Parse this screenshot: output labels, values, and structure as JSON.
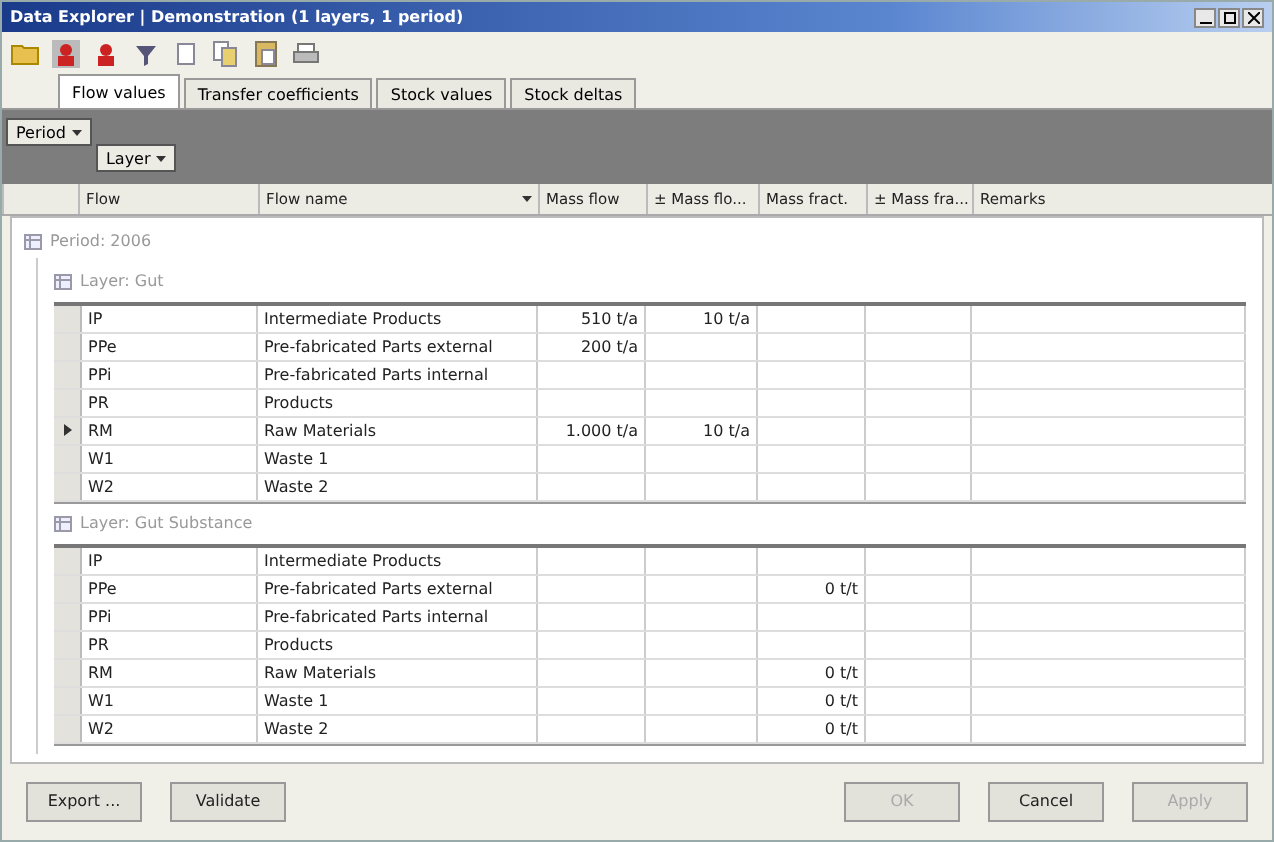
{
  "window": {
    "title": "Data Explorer | Demonstration (1 layers, 1 period)"
  },
  "tabs": [
    {
      "label": "Flow values",
      "selected": true
    },
    {
      "label": "Transfer coefficients",
      "selected": false
    },
    {
      "label": "Stock values",
      "selected": false
    },
    {
      "label": "Stock deltas",
      "selected": false
    }
  ],
  "grouping": [
    {
      "label": "Period"
    },
    {
      "label": "Layer"
    }
  ],
  "table": {
    "columns": [
      "Flow",
      "Flow name",
      "Mass flow",
      "± Mass flo...",
      "Mass fract.",
      "± Mass fra...",
      "Remarks"
    ],
    "period": "Period: 2006",
    "layers": [
      {
        "title": "Layer: Gut",
        "rows": [
          {
            "flow": "IP",
            "name": "Intermediate Products",
            "mass_flow": "510 t/a",
            "mass_flow_err": "10 t/a",
            "current": false
          },
          {
            "flow": "PPe",
            "name": "Pre-fabricated Parts external",
            "mass_flow": "200 t/a",
            "current": false
          },
          {
            "flow": "PPi",
            "name": "Pre-fabricated Parts internal",
            "current": false
          },
          {
            "flow": "PR",
            "name": "Products",
            "current": false
          },
          {
            "flow": "RM",
            "name": "Raw Materials",
            "mass_flow": "1.000 t/a",
            "mass_flow_err": "10 t/a",
            "current": true
          },
          {
            "flow": "W1",
            "name": "Waste 1",
            "current": false
          },
          {
            "flow": "W2",
            "name": "Waste 2",
            "current": false
          }
        ]
      },
      {
        "title": "Layer: Gut Substance",
        "rows": [
          {
            "flow": "IP",
            "name": "Intermediate Products",
            "current": false
          },
          {
            "flow": "PPe",
            "name": "Pre-fabricated Parts external",
            "mass_fraction": "0 t/t",
            "current": false
          },
          {
            "flow": "PPi",
            "name": "Pre-fabricated Parts internal",
            "current": false
          },
          {
            "flow": "PR",
            "name": "Products",
            "current": false
          },
          {
            "flow": "RM",
            "name": "Raw Materials",
            "mass_fraction": "0 t/t",
            "current": false
          },
          {
            "flow": "W1",
            "name": "Waste 1",
            "mass_fraction": "0 t/t",
            "current": false
          },
          {
            "flow": "W2",
            "name": "Waste 2",
            "mass_fraction": "0 t/t",
            "current": false
          }
        ]
      }
    ]
  },
  "buttons_left": [
    {
      "label": "Export ...",
      "disabled": false
    },
    {
      "label": "Validate",
      "disabled": false
    }
  ],
  "buttons_right": [
    {
      "label": "OK",
      "disabled": true
    },
    {
      "label": "Cancel",
      "disabled": false
    },
    {
      "label": "Apply",
      "disabled": true
    }
  ]
}
